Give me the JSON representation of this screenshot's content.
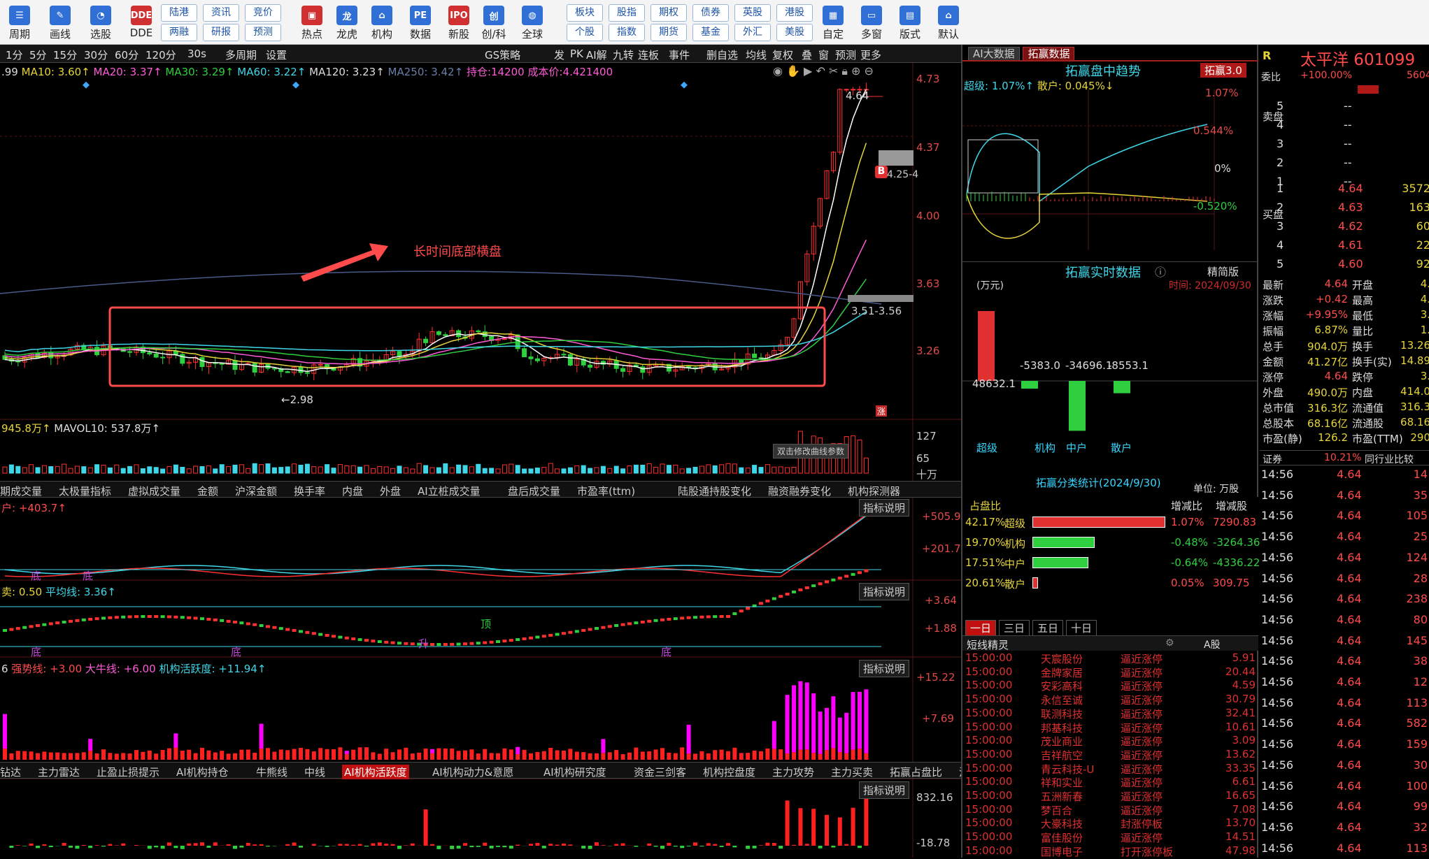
{
  "toolbar": {
    "items": [
      {
        "label": "周期",
        "icon": "cycle-icon",
        "color": "#2f6fd6",
        "glyph": "☰"
      },
      {
        "label": "画线",
        "icon": "pen-icon",
        "color": "#2f6fd6",
        "glyph": "✎"
      },
      {
        "label": "选股",
        "icon": "gauge-icon",
        "color": "#2f6fd6",
        "glyph": "◔"
      },
      {
        "label": "DDE",
        "icon": "dde-icon",
        "color": "#d03030",
        "glyph": "DDE"
      },
      {
        "label": "热点",
        "icon": "hotspot-icon",
        "color": "#d03030",
        "glyph": "▣"
      },
      {
        "label": "龙虎",
        "icon": "dragon-icon",
        "color": "#2f6fd6",
        "glyph": "龙"
      },
      {
        "label": "机构",
        "icon": "institution-icon",
        "color": "#2f6fd6",
        "glyph": "⌂"
      },
      {
        "label": "数据",
        "icon": "data-icon",
        "color": "#2f6fd6",
        "glyph": "PE"
      },
      {
        "label": "新股",
        "icon": "ipo-icon",
        "color": "#d03030",
        "glyph": "IPO"
      },
      {
        "label": "创/科",
        "icon": "chuang-icon",
        "color": "#2f6fd6",
        "glyph": "创"
      },
      {
        "label": "全球",
        "icon": "globe-icon",
        "color": "#2f6fd6",
        "glyph": "◍"
      },
      {
        "label": "自定",
        "icon": "custom-icon",
        "color": "#2f6fd6",
        "glyph": "▦"
      },
      {
        "label": "多窗",
        "icon": "multiwindow-icon",
        "color": "#2f6fd6",
        "glyph": "▭"
      },
      {
        "label": "版式",
        "icon": "layout-icon",
        "color": "#2f6fd6",
        "glyph": "▤"
      },
      {
        "label": "默认",
        "icon": "home-icon",
        "color": "#2f6fd6",
        "glyph": "⌂"
      }
    ],
    "small": [
      [
        "陆港",
        "两融"
      ],
      [
        "资讯",
        "研报"
      ],
      [
        "竞价",
        "预测"
      ],
      [
        "板块",
        "个股"
      ],
      [
        "股指",
        "指数"
      ],
      [
        "期权",
        "期货"
      ],
      [
        "债券",
        "基金"
      ],
      [
        "英股",
        "外汇"
      ],
      [
        "港股",
        "美股"
      ]
    ]
  },
  "tf": {
    "items": [
      "1分",
      "5分",
      "15分",
      "30分",
      "60分",
      "120分",
      "30s",
      "多周期",
      "设置"
    ],
    "strategy": "GS策略",
    "right_items": [
      "发",
      "PK",
      "AI解",
      "九转",
      "连板",
      "事件",
      "删自选",
      "均线",
      "复权",
      "叠",
      "窗",
      "预测",
      "更多"
    ]
  },
  "ma_line": {
    "v0": ".99",
    "ma10": "MA10: 3.60↑",
    "ma20": "MA20: 3.37↑",
    "ma30": "MA30: 3.29↑",
    "ma60": "MA60: 3.22↑",
    "ma120": "MA120: 3.23↑",
    "ma250": "MA250: 3.42↑",
    "hold": "持仓:14200 成本价:4.421400"
  },
  "main_axis": [
    "4.73",
    "4.37",
    "4.00",
    "3.63",
    "3.26"
  ],
  "annot": {
    "title": "长时间底部横盘",
    "hi": "4.64",
    "lo": "←2.98",
    "b_mark": "B",
    "r425": "4.25-4",
    "r351": "3.51-3.56",
    "zhang": "涨"
  },
  "vol": {
    "label": "945.8万↑",
    "mavol": "MAVOL10: 537.8万↑",
    "axis": [
      "127",
      "65",
      "十万"
    ],
    "tip": "双击修改曲线参数"
  },
  "vol_tabs": [
    "期成交量",
    "太极量指标",
    "虚拟成交量",
    "金额",
    "沪深金额",
    "换手率",
    "内盘",
    "外盘",
    "AI立桩成交量",
    "盘后成交量",
    "市盈率(ttm)",
    "陆股通持股变化",
    "融资融券变化",
    "机构探测器"
  ],
  "p1": {
    "label": "户: +403.7↑",
    "axis": [
      "+505.9",
      "+201.7"
    ],
    "btn": "指标说明",
    "marks": [
      "底",
      "底"
    ]
  },
  "p2": {
    "label": "卖: 0.50",
    "avg": "平均线: 3.36↑",
    "axis": [
      "+3.64",
      "+1.88"
    ],
    "btn": "指标说明",
    "marks": [
      "底",
      "底",
      "顶",
      "升",
      "底",
      "底"
    ]
  },
  "p3": {
    "label": "6",
    "strong": "强势线: +3.00",
    "bull": "大牛线: +6.00",
    "act": "机构活跃度: +11.94↑",
    "axis": [
      "+15.22",
      "+7.69"
    ],
    "btn": "指标说明"
  },
  "ind_tabs": [
    "钻达",
    "主力雷达",
    "止盈止损提示",
    "AI机构持仓",
    "牛熊线",
    "中线",
    "AI机构活跃度",
    "AI机构动力&意愿",
    "AI机构研究度",
    "资金三剑客",
    "机构控盘度",
    "主力攻势",
    "主力买卖",
    "拓赢占盘比",
    "波段决策"
  ],
  "ind_active": "AI机构活跃度",
  "p4": {
    "axis": [
      "832.16",
      "-18.78"
    ],
    "btn": "指标说明"
  },
  "right": {
    "tabs": [
      "AI大数据",
      "拓赢数据"
    ],
    "trend_title": "拓赢盘中趋势",
    "trend_badge": "拓赢3.0",
    "trend_legend_a": "超级: 1.07%↑",
    "trend_legend_b": "散户: 0.045%↓",
    "trend_axis": [
      "1.07%",
      "0.544%",
      "0%",
      "-0.520%"
    ],
    "rt_title": "拓赢实时数据",
    "rt_mode": "精简版",
    "rt_unit": "(万元)",
    "rt_time": "时间: 2024/09/30",
    "rt_vals": [
      "48632.1",
      "-5383.0",
      "-34696.1",
      "-8553.1"
    ],
    "rt_cats": [
      "超级",
      "机构",
      "中户",
      "散户"
    ],
    "stat_title": "拓赢分类统计(2024/9/30)",
    "stat_unit": "单位: 万股",
    "stat_head": [
      "占盘比",
      "增减比",
      "增减股"
    ],
    "stat_rows": [
      {
        "pct": "42.17%",
        "name": "超级",
        "chg": "1.07%",
        "shares": "7290.83",
        "w": 1.0,
        "color": "#e03030"
      },
      {
        "pct": "19.70%",
        "name": "机构",
        "chg": "-0.48%",
        "shares": "-3264.36",
        "w": 0.47,
        "color": "#2fcf3f"
      },
      {
        "pct": "17.51%",
        "name": "中户",
        "chg": "-0.64%",
        "shares": "-4336.22",
        "w": 0.42,
        "color": "#2fcf3f"
      },
      {
        "pct": "20.61%",
        "name": "散户",
        "chg": "0.05%",
        "shares": "309.75",
        "w": 0.04,
        "color": "#e03030"
      }
    ],
    "period_tabs": [
      "一日",
      "三日",
      "五日",
      "十日"
    ],
    "sp_title": "短线精灵",
    "sp_market": "A股",
    "sprite": [
      [
        "15:00:00",
        "天宸股份",
        "逼近涨停",
        "5.91"
      ],
      [
        "15:00:00",
        "金牌家居",
        "逼近涨停",
        "20.44"
      ],
      [
        "15:00:00",
        "安彩高科",
        "逼近涨停",
        "4.59"
      ],
      [
        "15:00:00",
        "永信至诚",
        "逼近涨停",
        "30.79"
      ],
      [
        "15:00:00",
        "联测科技",
        "逼近涨停",
        "32.41"
      ],
      [
        "15:00:00",
        "邦基科技",
        "逼近涨停",
        "10.61"
      ],
      [
        "15:00:00",
        "茂业商业",
        "逼近涨停",
        "3.09"
      ],
      [
        "15:00:00",
        "吉祥航空",
        "逼近涨停",
        "13.62"
      ],
      [
        "15:00:00",
        "青云科技-U",
        "逼近涨停",
        "33.35"
      ],
      [
        "15:00:00",
        "祥和实业",
        "逼近涨停",
        "6.61"
      ],
      [
        "15:00:00",
        "五洲新春",
        "逼近涨停",
        "16.65"
      ],
      [
        "15:00:00",
        "梦百合",
        "逼近涨停",
        "7.08"
      ],
      [
        "15:00:00",
        "大豪科技",
        "封涨停板",
        "13.70"
      ],
      [
        "15:00:00",
        "富佳股份",
        "逼近涨停",
        "14.51"
      ],
      [
        "15:00:00",
        "国博电子",
        "打开涨停板",
        "47.98"
      ]
    ],
    "quote": {
      "r": "R",
      "name": "太平洋 601099",
      "weibi_k": "委比",
      "weibi": "+100.00%",
      "weibi_r": "5604",
      "sell": [
        [
          "5",
          "--"
        ],
        [
          "4",
          "--"
        ],
        [
          "3",
          "--"
        ],
        [
          "2",
          "--"
        ],
        [
          "1",
          "--"
        ]
      ],
      "buy": [
        [
          "1",
          "4.64",
          "3572"
        ],
        [
          "2",
          "4.63",
          "163"
        ],
        [
          "3",
          "4.62",
          "60"
        ],
        [
          "4",
          "4.61",
          "22"
        ],
        [
          "5",
          "4.60",
          "92"
        ]
      ],
      "sell_side": "卖盘",
      "buy_side": "买盘",
      "stats": [
        [
          "最新",
          "4.64",
          "开盘",
          "4."
        ],
        [
          "涨跌",
          "+0.42",
          "最高",
          "4."
        ],
        [
          "涨幅",
          "+9.95%",
          "最低",
          "3."
        ],
        [
          "振幅",
          "6.87%",
          "量比",
          "1."
        ],
        [
          "总手",
          "904.0万",
          "换手",
          "13.26"
        ],
        [
          "金额",
          "41.27亿",
          "换手(实)",
          "14.89"
        ],
        [
          "涨停",
          "4.64",
          "跌停",
          "3."
        ],
        [
          "外盘",
          "490.0万",
          "内盘",
          "414.0"
        ],
        [
          "总市值",
          "316.3亿",
          "流通值",
          "316.3"
        ],
        [
          "总股本",
          "68.16亿",
          "流通股",
          "68.16"
        ],
        [
          "市盈(静)",
          "126.2",
          "市盈(TTM)",
          "290"
        ]
      ],
      "zq": [
        "证券",
        "10.21%",
        "同行业比较"
      ],
      "ticks": [
        [
          "14:56",
          "4.64",
          "14"
        ],
        [
          "14:56",
          "4.64",
          "35"
        ],
        [
          "14:56",
          "4.64",
          "105"
        ],
        [
          "14:56",
          "4.64",
          "25"
        ],
        [
          "14:56",
          "4.64",
          "124"
        ],
        [
          "14:56",
          "4.64",
          "28"
        ],
        [
          "14:56",
          "4.64",
          "238"
        ],
        [
          "14:56",
          "4.64",
          "80"
        ],
        [
          "14:56",
          "4.64",
          "145"
        ],
        [
          "14:56",
          "4.64",
          "38"
        ],
        [
          "14:56",
          "4.64",
          "12"
        ],
        [
          "14:56",
          "4.64",
          "113"
        ],
        [
          "14:56",
          "4.64",
          "582"
        ],
        [
          "14:56",
          "4.64",
          "159"
        ],
        [
          "14:56",
          "4.64",
          "30"
        ],
        [
          "14:56",
          "4.64",
          "100"
        ],
        [
          "14:56",
          "4.64",
          "99"
        ],
        [
          "14:56",
          "4.64",
          "32"
        ],
        [
          "14:56",
          "4.64",
          "113"
        ]
      ]
    }
  }
}
